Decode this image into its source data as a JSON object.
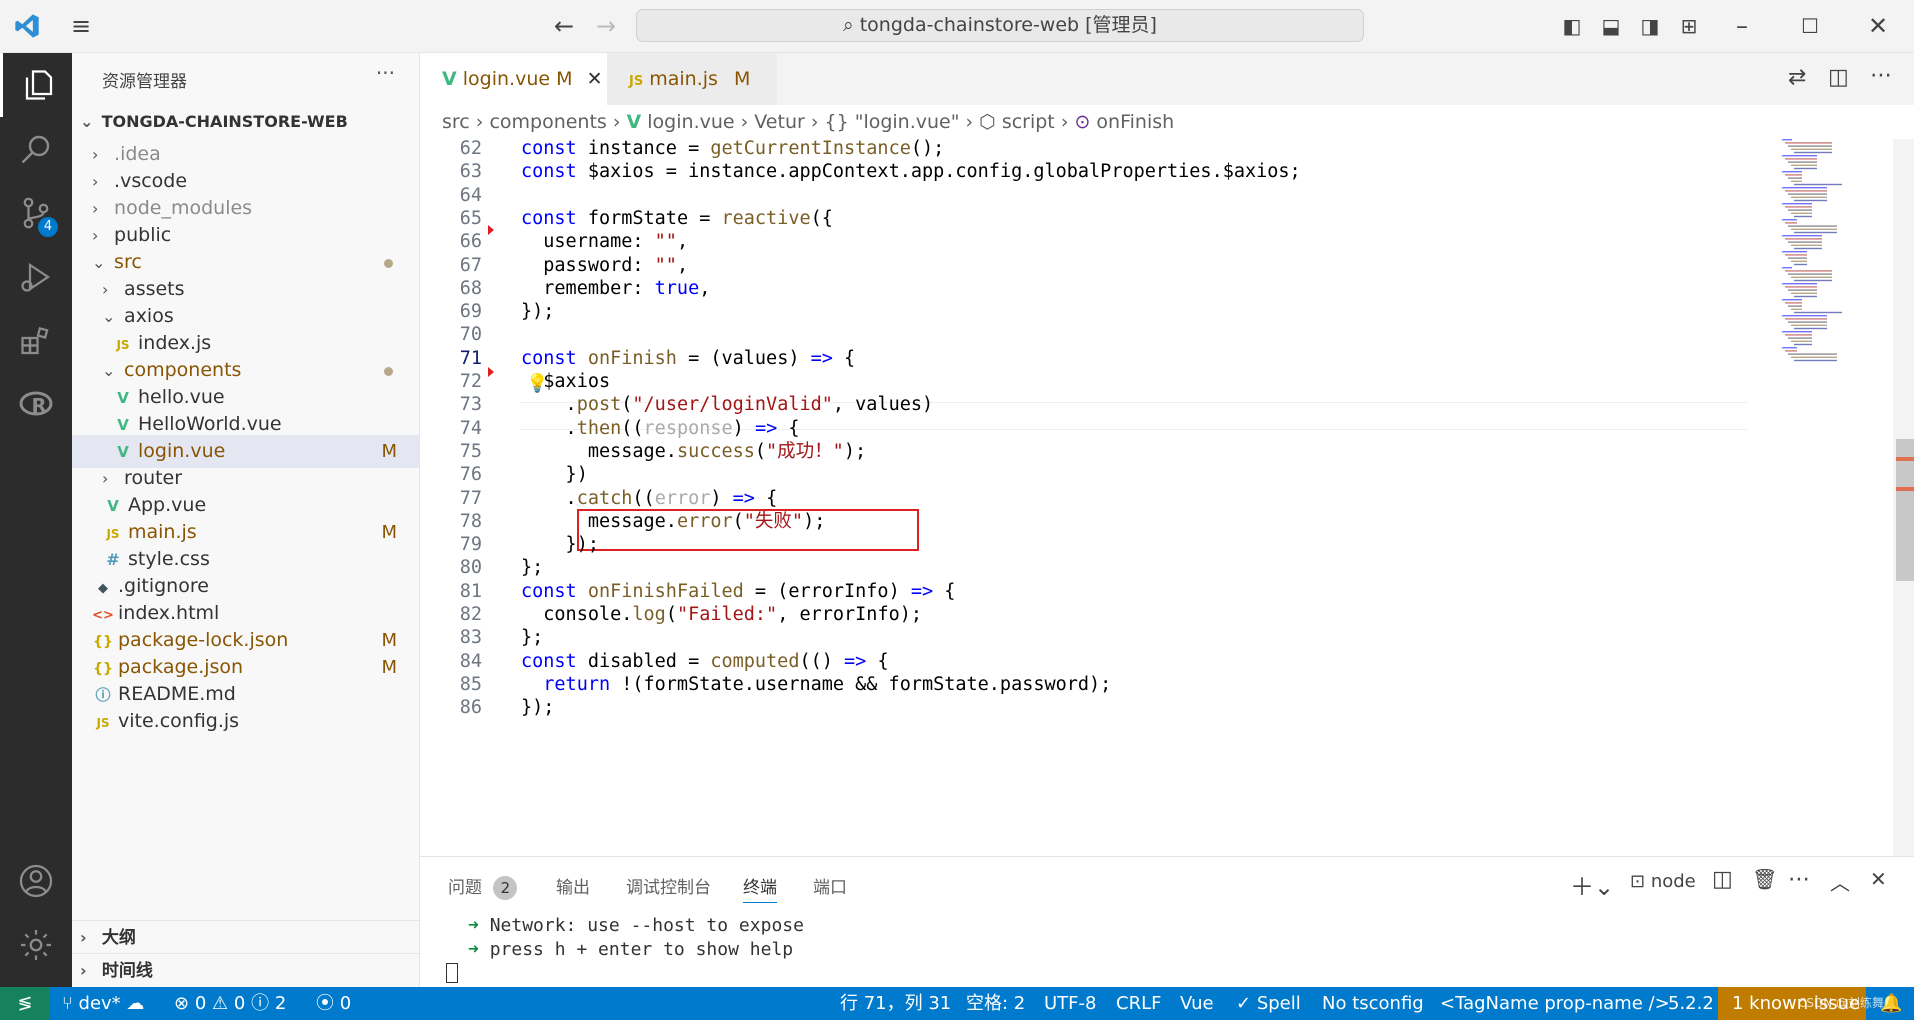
{
  "title": "tongda-chainstore-web [管理员]",
  "sidebar": {
    "title": "资源管理器",
    "root": "TONGDA-CHAINSTORE-WEB",
    "items": [
      {
        "label": ".idea",
        "type": "folder",
        "depth": 1,
        "open": false,
        "muted": true
      },
      {
        "label": ".vscode",
        "type": "folder",
        "depth": 1,
        "open": false
      },
      {
        "label": "node_modules",
        "type": "folder",
        "depth": 1,
        "open": false,
        "muted": true
      },
      {
        "label": "public",
        "type": "folder",
        "depth": 1,
        "open": false
      },
      {
        "label": "src",
        "type": "folder",
        "depth": 1,
        "open": true,
        "dot": true,
        "orange": true
      },
      {
        "label": "assets",
        "type": "folder",
        "depth": 2,
        "open": false
      },
      {
        "label": "axios",
        "type": "folder",
        "depth": 2,
        "open": true
      },
      {
        "label": "index.js",
        "type": "js",
        "depth": 3
      },
      {
        "label": "components",
        "type": "folder",
        "depth": 2,
        "open": true,
        "dot": true,
        "orange": true
      },
      {
        "label": "hello.vue",
        "type": "vue",
        "depth": 3
      },
      {
        "label": "HelloWorld.vue",
        "type": "vue",
        "depth": 3
      },
      {
        "label": "login.vue",
        "type": "vue",
        "depth": 3,
        "badge": "M",
        "selected": true,
        "orange": true
      },
      {
        "label": "router",
        "type": "folder",
        "depth": 2,
        "open": false
      },
      {
        "label": "App.vue",
        "type": "vue",
        "depth": 2
      },
      {
        "label": "main.js",
        "type": "js",
        "depth": 2,
        "badge": "M",
        "orange": true
      },
      {
        "label": "style.css",
        "type": "css",
        "depth": 2
      },
      {
        "label": ".gitignore",
        "type": "git",
        "depth": 1
      },
      {
        "label": "index.html",
        "type": "html",
        "depth": 1
      },
      {
        "label": "package-lock.json",
        "type": "json",
        "depth": 1,
        "badge": "M",
        "orange": true
      },
      {
        "label": "package.json",
        "type": "json",
        "depth": 1,
        "badge": "M",
        "orange": true
      },
      {
        "label": "README.md",
        "type": "md",
        "depth": 1
      },
      {
        "label": "vite.config.js",
        "type": "js",
        "depth": 1
      }
    ],
    "outline": "大纲",
    "timeline": "时间线"
  },
  "tabs": [
    {
      "label": "login.vue",
      "badge": "M",
      "active": true
    },
    {
      "label": "main.js",
      "badge": "M",
      "active": false
    }
  ],
  "breadcrumb": [
    "src",
    "components",
    "login.vue",
    "Vetur",
    "{} \"login.vue\"",
    "script",
    "onFinish"
  ],
  "code": [
    {
      "n": "62",
      "html": "<span class='k'>const</span> instance = <span class='f'>getCurrentInstance</span>();"
    },
    {
      "n": "63",
      "html": "<span class='k'>const</span> $axios = instance.appContext.app.config.globalProperties.$axios;"
    },
    {
      "n": "64",
      "html": ""
    },
    {
      "n": "65",
      "html": "<span class='k'>const</span> formState = <span class='f'>reactive</span>({"
    },
    {
      "n": "66",
      "html": "  username: <span class='s'>\"\"</span>,"
    },
    {
      "n": "67",
      "html": "  password: <span class='s'>\"\"</span>,"
    },
    {
      "n": "68",
      "html": "  remember: <span class='k'>true</span>,"
    },
    {
      "n": "69",
      "html": "});"
    },
    {
      "n": "70",
      "html": ""
    },
    {
      "n": "71",
      "html": "<span class='k'>const</span> <span class='f'>onFinish</span> = (values) <span class='k'>=&gt;</span> {"
    },
    {
      "n": "72",
      "html": "  $axios"
    },
    {
      "n": "73",
      "html": "    .<span class='f'>post</span>(<span class='s'>\"/user/loginValid\"</span>, values)"
    },
    {
      "n": "74",
      "html": "    .<span class='f'>then</span>((<span class='p'>response</span>) <span class='k'>=&gt;</span> {"
    },
    {
      "n": "75",
      "html": "      message.<span class='f'>success</span>(<span class='s'>\"成功！\"</span>);"
    },
    {
      "n": "76",
      "html": "    })"
    },
    {
      "n": "77",
      "html": "    .<span class='f'>catch</span>((<span class='p'>error</span>) <span class='k'>=&gt;</span> {"
    },
    {
      "n": "78",
      "html": "      message.<span class='f'>error</span>(<span class='s'>\"失败\"</span>);"
    },
    {
      "n": "79",
      "html": "    });"
    },
    {
      "n": "80",
      "html": "};"
    },
    {
      "n": "81",
      "html": "<span class='k'>const</span> <span class='f'>onFinishFailed</span> = (errorInfo) <span class='k'>=&gt;</span> {"
    },
    {
      "n": "82",
      "html": "  console.<span class='f'>log</span>(<span class='s'>\"Failed:\"</span>, errorInfo);"
    },
    {
      "n": "83",
      "html": "};"
    },
    {
      "n": "84",
      "html": "<span class='k'>const</span> disabled = <span class='f'>computed</span>(() <span class='k'>=&gt;</span> {"
    },
    {
      "n": "85",
      "html": "  <span class='k'>return</span> !(formState.username &amp;&amp; formState.password);"
    },
    {
      "n": "86",
      "html": "});"
    }
  ],
  "current_line": "71",
  "panel": {
    "tabs": [
      "问题",
      "输出",
      "调试控制台",
      "终端",
      "端口"
    ],
    "problems_count": "2",
    "active_tab": "终端",
    "terminal_name": "node",
    "lines": [
      {
        "arrow": "➜",
        "text": "Network: use --host to expose"
      },
      {
        "arrow": "➜",
        "text": "press h + enter to show help"
      }
    ]
  },
  "status": {
    "branch": "dev*",
    "errors": "0",
    "warnings": "0",
    "infos": "2",
    "ports": "0",
    "position": "行 71，列 31",
    "spaces": "空格: 2",
    "encoding": "UTF-8",
    "eol": "CRLF",
    "language": "Vue",
    "spell": "Spell",
    "tsconfig": "No tsconfig",
    "tag": "<TagName prop-name />",
    "version": "5.2.2",
    "issue": "1 known issue",
    "watermark": "CSDN @刘练舞"
  },
  "scm_badge": "4",
  "colors": {
    "accent": "#007acc",
    "highlight_box": "#e02020",
    "issue_bg": "#c07c00"
  }
}
